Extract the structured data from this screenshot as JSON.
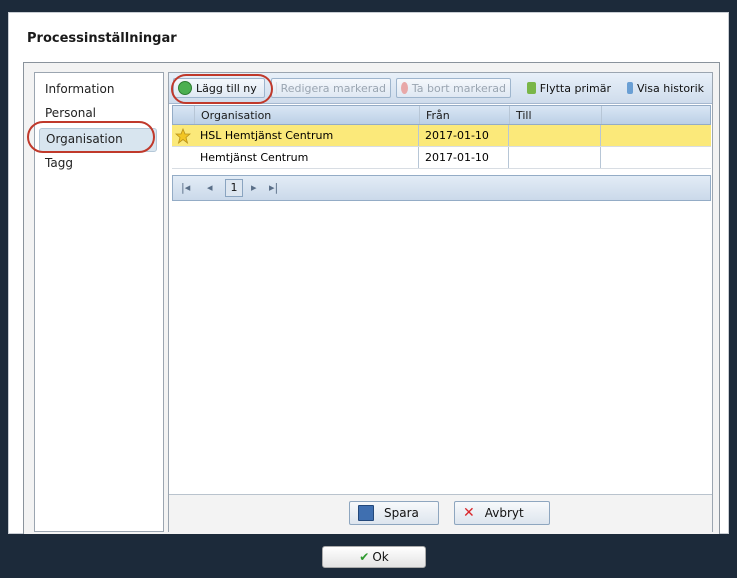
{
  "dialog": {
    "title": "Processinställningar"
  },
  "sidebar": {
    "items": [
      {
        "label": "Information"
      },
      {
        "label": "Personal"
      },
      {
        "label": "Organisation",
        "selected": true
      },
      {
        "label": "Tagg"
      }
    ]
  },
  "toolbar": {
    "add_label": "Lägg till ny",
    "edit_label": "Redigera markerad",
    "delete_label": "Ta bort markerad",
    "move_label": "Flytta primär",
    "history_label": "Visa historik"
  },
  "grid": {
    "columns": [
      "Organisation",
      "Från",
      "Till"
    ],
    "rows": [
      {
        "organisation": "HSL Hemtjänst Centrum",
        "from": "2017-01-10",
        "to": "",
        "primary": true,
        "selected": true
      },
      {
        "organisation": "Hemtjänst Centrum",
        "from": "2017-01-10",
        "to": "",
        "primary": false,
        "selected": false
      }
    ]
  },
  "pager": {
    "page": "1"
  },
  "actions": {
    "save_label": "Spara",
    "cancel_label": "Avbryt"
  },
  "footer": {
    "ok_label": "Ok"
  },
  "colors": {
    "highlight": "#c0392b",
    "selected_row": "#fbe97a",
    "dark_bg": "#1c2a3a"
  },
  "icons": {
    "add": "plus-circle-icon",
    "edit": "pencil-icon",
    "delete": "minus-circle-icon",
    "move": "move-arrow-icon",
    "history": "history-icon",
    "primary": "star-icon",
    "save": "floppy-icon",
    "cancel": "close-icon",
    "ok": "checkmark-icon"
  }
}
